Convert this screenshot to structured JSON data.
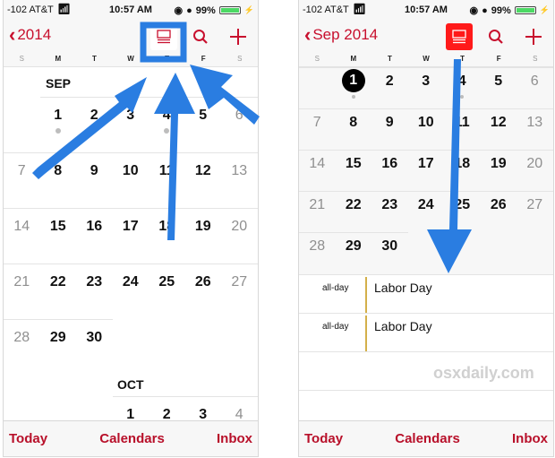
{
  "status_bar": {
    "carrier": "-102 AT&T",
    "time": "10:57 AM",
    "battery": "99%",
    "battery_level": 0.99
  },
  "colors": {
    "accent": "#c8102e",
    "highlight_box": "#2a7de1",
    "arrow": "#2a7de1",
    "list_toggle_active": "#ff1a1a",
    "event_bar": "#d4b04a"
  },
  "left_screen": {
    "back_label": "2014",
    "icons": [
      "chevron-left-icon",
      "list-view-icon",
      "search-icon",
      "plus-icon"
    ],
    "weekdays": [
      "S",
      "M",
      "T",
      "W",
      "T",
      "F",
      "S"
    ],
    "month_label": "SEP",
    "weeks": [
      [
        "",
        "1",
        "2",
        "3",
        "4",
        "5",
        "6"
      ],
      [
        "7",
        "8",
        "9",
        "10",
        "11",
        "12",
        "13"
      ],
      [
        "14",
        "15",
        "16",
        "17",
        "18",
        "19",
        "20"
      ],
      [
        "21",
        "22",
        "23",
        "24",
        "25",
        "26",
        "27"
      ],
      [
        "28",
        "29",
        "30",
        "",
        "",
        "",
        ""
      ]
    ],
    "dots_on": [
      "1",
      "4"
    ],
    "next_month_label": "OCT",
    "next_month_row": [
      "",
      "",
      "",
      "1",
      "2",
      "3",
      "4"
    ],
    "list_toggle_active": false
  },
  "right_screen": {
    "back_label": "Sep 2014",
    "weekdays": [
      "S",
      "M",
      "T",
      "W",
      "T",
      "F",
      "S"
    ],
    "weeks": [
      [
        "",
        "1",
        "2",
        "3",
        "4",
        "5",
        "6"
      ],
      [
        "7",
        "8",
        "9",
        "10",
        "11",
        "12",
        "13"
      ],
      [
        "14",
        "15",
        "16",
        "17",
        "18",
        "19",
        "20"
      ],
      [
        "21",
        "22",
        "23",
        "24",
        "25",
        "26",
        "27"
      ],
      [
        "28",
        "29",
        "30",
        "",
        "",
        "",
        ""
      ]
    ],
    "selected_day": "1",
    "dots_on": [
      "1",
      "4"
    ],
    "list_toggle_active": true,
    "events": [
      {
        "time": "all-day",
        "title": "Labor Day"
      },
      {
        "time": "all-day",
        "title": "Labor Day"
      }
    ],
    "watermark": "osxdaily.com"
  },
  "tab_bar": {
    "today": "Today",
    "calendars": "Calendars",
    "inbox": "Inbox"
  }
}
